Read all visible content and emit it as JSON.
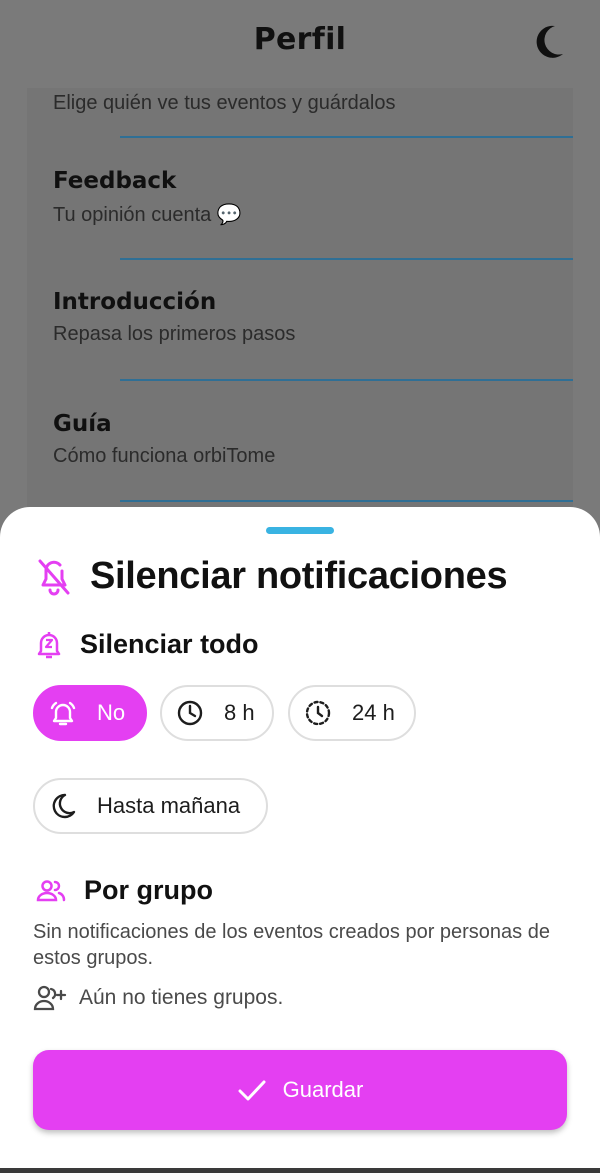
{
  "header": {
    "title": "Perfil",
    "theme_icon": "moon-icon"
  },
  "profile_items": [
    {
      "title": "",
      "subtitle": "Elige quién ve tus eventos y guárdalos"
    },
    {
      "title": "Feedback",
      "subtitle": "Tu opinión cuenta 💬"
    },
    {
      "title": "Introducción",
      "subtitle": "Repasa los primeros pasos"
    },
    {
      "title": "Guía",
      "subtitle": "Cómo funciona orbiTome"
    }
  ],
  "sheet": {
    "title": "Silenciar notificaciones",
    "mute_all": {
      "title": "Silenciar todo",
      "options": [
        {
          "label": "No",
          "icon": "bell-ringing-icon",
          "selected": true
        },
        {
          "label": "8 h",
          "icon": "clock-icon",
          "selected": false
        },
        {
          "label": "24 h",
          "icon": "dashed-clock-icon",
          "selected": false
        },
        {
          "label": "Hasta mañana",
          "icon": "moon-icon",
          "selected": false
        }
      ]
    },
    "by_group": {
      "title": "Por grupo",
      "description": "Sin notificaciones de los eventos creados por personas de estos grupos.",
      "empty_text": "Aún no tienes grupos."
    },
    "save_label": "Guardar"
  },
  "colors": {
    "accent": "#e43ff2",
    "handle": "#39b3e2",
    "separator": "#2f6f95"
  }
}
